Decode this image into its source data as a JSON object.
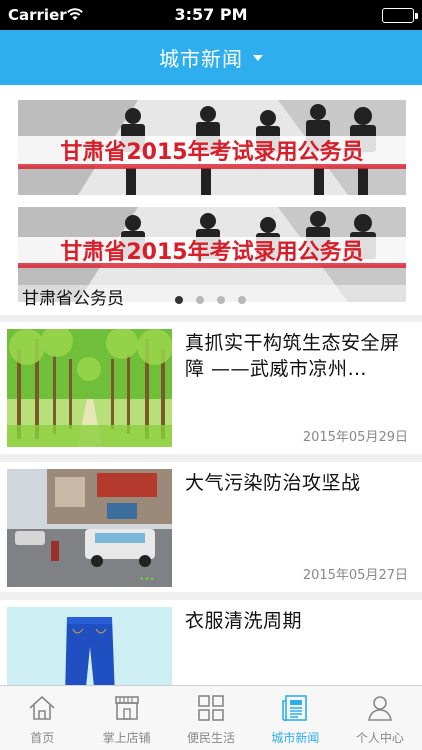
{
  "status_bar": {
    "carrier": "Carrier",
    "time": "3:57 PM"
  },
  "nav": {
    "title": "城市新闻"
  },
  "banner": {
    "poster_text": "甘肃省2015年考试录用公务员",
    "caption": "甘肃省公务员",
    "page_count": 4,
    "active_index": 0
  },
  "news": [
    {
      "title": "真抓实干构筑生态安全屏障 ——武威市凉州…",
      "date": "2015年05月29日",
      "thumb": "forest-road"
    },
    {
      "title": "大气污染防治攻坚战",
      "date": "2015年05月27日",
      "thumb": "street-traffic"
    },
    {
      "title": "衣服清洗周期",
      "date": "",
      "thumb": "jeans"
    }
  ],
  "tabs": [
    {
      "label": "首页",
      "icon": "home-icon",
      "active": false
    },
    {
      "label": "掌上店铺",
      "icon": "store-icon",
      "active": false
    },
    {
      "label": "便民生活",
      "icon": "grid-icon",
      "active": false
    },
    {
      "label": "城市新闻",
      "icon": "newspaper-icon",
      "active": true
    },
    {
      "label": "个人中心",
      "icon": "user-icon",
      "active": false
    }
  ],
  "colors": {
    "accent": "#2eaeec",
    "poster_red": "#d81e2a"
  }
}
